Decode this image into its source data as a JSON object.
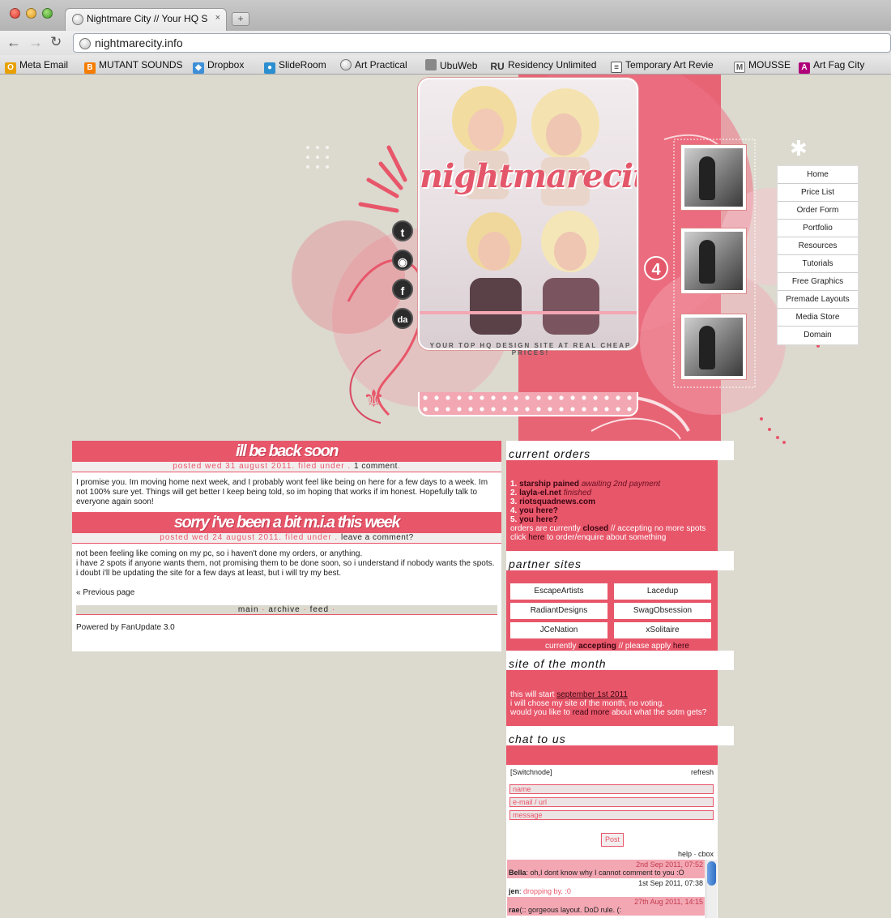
{
  "browser": {
    "tab_title": "Nightmare City // Your HQ S",
    "tab_close": "×",
    "new_tab": "+",
    "url": "nightmarecity.info",
    "back": "←",
    "forward": "→",
    "reload": "↻"
  },
  "bookmarks": [
    {
      "label": "Meta Email",
      "icon": "O",
      "color": "#e8a100"
    },
    {
      "label": "MUTANT SOUNDS",
      "icon": "B",
      "color": "#f57d00"
    },
    {
      "label": "Dropbox",
      "icon": "◆",
      "color": "#3d8fd8"
    },
    {
      "label": "SlideRoom",
      "icon": "●",
      "color": "#2b8fd0"
    },
    {
      "label": "Art Practical",
      "icon": "",
      "color": "#999999"
    },
    {
      "label": "UbuWeb",
      "icon": "",
      "color": "#888888"
    },
    {
      "label": "Residency Unlimited",
      "icon": "RU",
      "color": "#333333"
    },
    {
      "label": "Temporary Art Revie",
      "icon": "≡",
      "color": "#444444"
    },
    {
      "label": "MOUSSE",
      "icon": "M",
      "color": "#666666"
    },
    {
      "label": "Art Fag City",
      "icon": "A",
      "color": "#b0007a"
    }
  ],
  "header": {
    "logo": "nightmarecity",
    "version": "4",
    "tagline": "YOUR TOP HQ DESIGN SITE AT REAL CHEAP PRICES!"
  },
  "social": [
    {
      "name": "twitter-icon",
      "glyph": "t"
    },
    {
      "name": "rss-icon",
      "glyph": "◉"
    },
    {
      "name": "facebook-icon",
      "glyph": "f"
    },
    {
      "name": "deviantart-icon",
      "glyph": "da"
    }
  ],
  "nav": [
    "Home",
    "Price List",
    "Order Form",
    "Portfolio",
    "Resources",
    "Tutorials",
    "Free Graphics",
    "Premade Layouts",
    "Media Store",
    "Domain"
  ],
  "posts": [
    {
      "title": "ill be back soon",
      "meta_prefix": "posted wed 31 august 2011. filed under . ",
      "meta_link": "1 comment",
      "meta_suffix": ".",
      "body": [
        "I promise you. Im moving home next week, and I probably wont feel like being on here for a few days to a week. Im not 100% sure yet. Things will get better I keep being told, so im hoping that works if im honest. Hopefully talk to everyone again soon!"
      ]
    },
    {
      "title": "sorry i've been a bit m.i.a this week",
      "meta_prefix": "posted wed 24 august 2011. filed under . ",
      "meta_link": "leave a comment?",
      "meta_suffix": "",
      "body": [
        "not been feeling like coming on my pc, so i haven't done my orders, or anything.",
        "i have 2 spots if anyone wants them, not promising them to be done soon, so i understand if nobody wants the spots.",
        "i doubt i'll be updating the site for a few days at least, but i will try my best."
      ]
    }
  ],
  "prev_page": "« Previous page",
  "footer_links": [
    "main",
    "archive",
    "feed"
  ],
  "powered_by": "Powered by FanUpdate 3.0",
  "sidebar": {
    "orders_heading": "current orders",
    "orders": [
      {
        "num": "1.",
        "name": "starship pained",
        "status": "awaiting 2nd payment"
      },
      {
        "num": "2.",
        "name": "layla-el.net",
        "status": "finished"
      },
      {
        "num": "3.",
        "name": "riotsquadnews.com",
        "status": ""
      },
      {
        "num": "4.",
        "name": "you here?",
        "status": ""
      },
      {
        "num": "5.",
        "name": "you here?",
        "status": ""
      }
    ],
    "orders_closed_prefix": "orders are currently ",
    "orders_closed_word": "closed",
    "orders_closed_suffix": " // accepting no more spots",
    "orders_click": "click ",
    "orders_here": "here",
    "orders_click_suffix": " to order/enquire about something",
    "partners_heading": "partner sites",
    "partners": [
      "EscapeArtists",
      "Lacedup",
      "RadiantDesigns",
      "SwagObsession",
      "JCeNation",
      "xSolitaire"
    ],
    "partners_status_prefix": "currently ",
    "partners_status_word": "accepting",
    "partners_status_suffix": " // please apply ",
    "partners_here": "here",
    "sotm_heading": "site of the month",
    "sotm_line1_prefix": "this will start ",
    "sotm_line1_date": "september 1st 2011",
    "sotm_line2": "i will chose my site of the month, no voting.",
    "sotm_line3_prefix": "would you like to ",
    "sotm_line3_link": "read more",
    "sotm_line3_suffix": " about what the sotm gets?",
    "chat_heading": "chat to us"
  },
  "chat": {
    "switchnode": "[Switchnode]",
    "refresh": "refresh",
    "name_placeholder": "name",
    "email_placeholder": "e-mail / url",
    "message_placeholder": "message",
    "post_button": "Post",
    "help": "help · cbox",
    "messages": [
      {
        "date": "2nd Sep 2011, 07:52",
        "author": "Bella",
        "text": ": oh,I dont know why I cannot comment to you :O",
        "link": "",
        "alt": true
      },
      {
        "date": "1st Sep 2011, 07:38",
        "author": "jen",
        "text": ": ",
        "link": "dropping by. :0",
        "alt": false
      },
      {
        "date": "27th Aug 2011, 14:15",
        "author": "rae",
        "text": "(:: gorgeous layout. DoD rule. (:",
        "link": "",
        "alt": true
      }
    ]
  },
  "colors": {
    "accent": "#e8566a",
    "page_bg": "#dcd9cf"
  }
}
